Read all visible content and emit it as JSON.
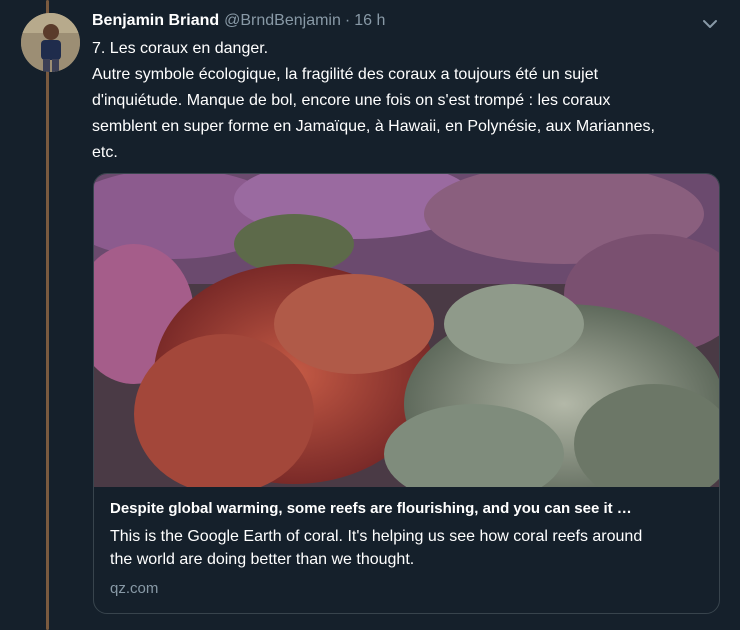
{
  "tweet": {
    "author_name": "Benjamin Briand",
    "author_handle": "@BrndBenjamin",
    "separator": "·",
    "time": "16 h",
    "text_lines": [
      "7. Les coraux en danger.",
      "Autre symbole écologique, la fragilité des coraux a toujours été un sujet",
      "d'inquiétude. Manque de bol, encore une fois on s'est trompé : les coraux",
      "semblent en super forme en Jamaïque, à Hawaii, en Polynésie, aux Mariannes,",
      "etc."
    ],
    "menu_icon": "chevron-down-icon"
  },
  "card": {
    "title": "Despite global warming, some reefs are flourishing, and you can see it …",
    "description_lines": [
      "This is the Google Earth of coral. It's helping us see how coral reefs around",
      "the world are doing better than we thought."
    ],
    "domain": "qz.com"
  },
  "colors": {
    "background": "#15202b",
    "secondary_text": "#8899a6",
    "border": "#38444d",
    "thread_line": "#7a5a3f"
  }
}
